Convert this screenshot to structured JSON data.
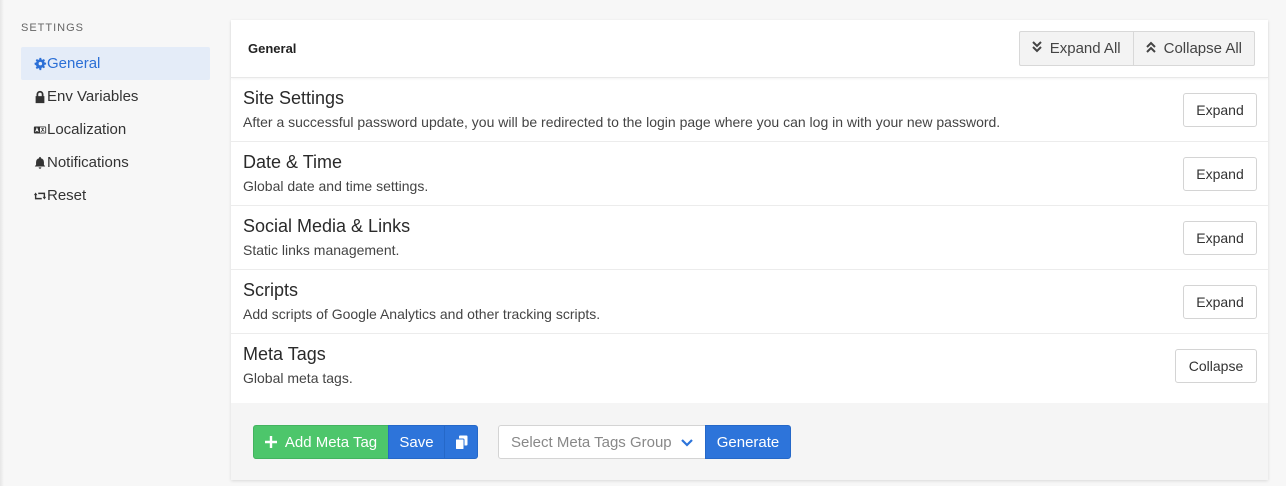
{
  "sidebar": {
    "heading": "SETTINGS",
    "items": [
      {
        "label": "General",
        "icon": "gear-icon",
        "active": true
      },
      {
        "label": "Env Variables",
        "icon": "lock-icon",
        "active": false
      },
      {
        "label": "Localization",
        "icon": "language-icon",
        "active": false
      },
      {
        "label": "Notifications",
        "icon": "bell-icon",
        "active": false
      },
      {
        "label": "Reset",
        "icon": "retweet-icon",
        "active": false
      }
    ]
  },
  "header": {
    "title": "General",
    "expand_all": "Expand All",
    "collapse_all": "Collapse All"
  },
  "sections": [
    {
      "title": "Site Settings",
      "description": "After a successful password update, you will be redirected to the login page where you can log in with your new password.",
      "button": "Expand"
    },
    {
      "title": "Date & Time",
      "description": "Global date and time settings.",
      "button": "Expand"
    },
    {
      "title": "Social Media & Links",
      "description": "Static links management.",
      "button": "Expand"
    },
    {
      "title": "Scripts",
      "description": "Add scripts of Google Analytics and other tracking scripts.",
      "button": "Expand"
    },
    {
      "title": "Meta Tags",
      "description": "Global meta tags.",
      "button": "Collapse"
    }
  ],
  "footer": {
    "add_meta_tag": "Add Meta Tag",
    "save": "Save",
    "select_placeholder": "Select Meta Tags Group",
    "generate": "Generate"
  },
  "colors": {
    "accent": "#2d74da",
    "success": "#4dc66b",
    "active_bg": "#e4ecf8"
  }
}
